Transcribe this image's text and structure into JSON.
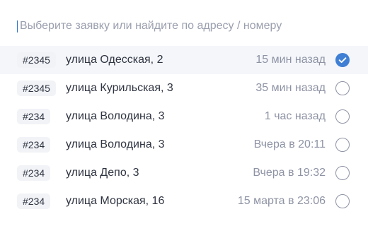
{
  "search": {
    "placeholder": "Выберите заявку или найдите по адресу / номеру",
    "value": ""
  },
  "colors": {
    "accent": "#3f7fd4",
    "selected_row_bg": "#f4f6fa",
    "badge_bg": "#f1f3f7",
    "muted_text": "#8e93a4"
  },
  "requests": [
    {
      "number": "#2345",
      "address": "улица Одесская, 2",
      "time": "15 мин назад",
      "selected": true
    },
    {
      "number": "#2345",
      "address": "улица Курильская, 3",
      "time": "35 мин назад",
      "selected": false
    },
    {
      "number": "#234",
      "address": "улица Володина, 3",
      "time": "1 час назад",
      "selected": false
    },
    {
      "number": "#234",
      "address": "улица Володина, 3",
      "time": "Вчера в 20:11",
      "selected": false
    },
    {
      "number": "#234",
      "address": "улица Депо, 3",
      "time": "Вчера в 19:32",
      "selected": false
    },
    {
      "number": "#234",
      "address": "улица Морская, 16",
      "time": "15 марта в 23:06",
      "selected": false
    }
  ]
}
